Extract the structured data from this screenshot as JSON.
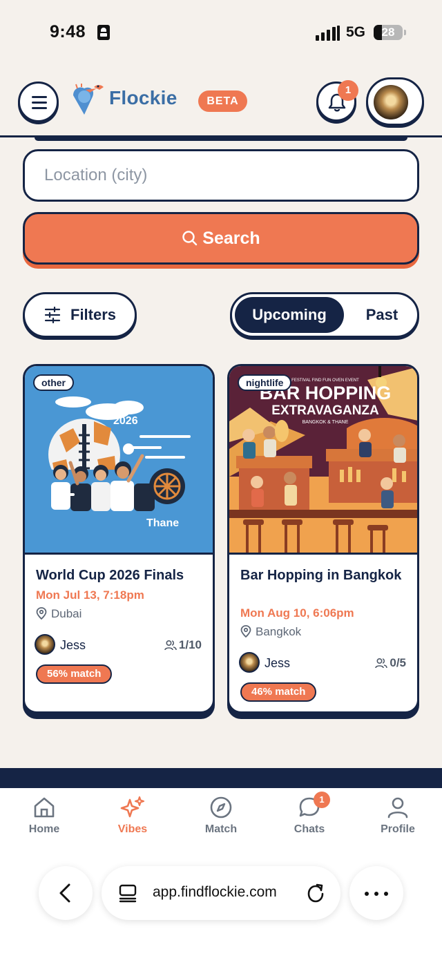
{
  "status_bar": {
    "time": "9:48",
    "network": "5G",
    "battery": "28"
  },
  "header": {
    "brand": "Flockie",
    "beta": "BETA",
    "notification_count": "1",
    "icons": {
      "menu": "hamburger-menu-icon",
      "bell": "bell-icon",
      "logo": "bird-pin-logo"
    }
  },
  "search": {
    "location_placeholder": "Location (city)",
    "location_value": "",
    "search_label": "Search"
  },
  "filters": {
    "label": "Filters"
  },
  "toggle": {
    "upcoming": "Upcoming",
    "past": "Past",
    "selected": "Upcoming"
  },
  "events": [
    {
      "tag": "other",
      "title": "World Cup 2026 Finals",
      "date": "Mon Jul 13, 7:18pm",
      "location": "Dubai",
      "host": "Jess",
      "attendance": "1/10",
      "match": "56% match",
      "poster": {
        "year": "2026",
        "city": "Thane"
      }
    },
    {
      "tag": "nightlife",
      "title": "Bar Hopping in Bangkok",
      "date": "Mon Aug 10, 6:06pm",
      "location": "Bangkok",
      "host": "Jess",
      "attendance": "0/5",
      "match": "46% match",
      "poster": {
        "top": "FESTIVAL FIND FUN OVEN EVENT",
        "line1": "BAR HOPPING",
        "line2": "EXTRAVAGANZA",
        "sub": "BANGKOK & THANE"
      }
    }
  ],
  "nav": {
    "items": [
      {
        "label": "Home",
        "icon": "home-icon"
      },
      {
        "label": "Vibes",
        "icon": "sparkles-icon",
        "active": true
      },
      {
        "label": "Match",
        "icon": "compass-icon"
      },
      {
        "label": "Chats",
        "icon": "chat-bubble-icon"
      },
      {
        "label": "Profile",
        "icon": "person-icon"
      }
    ],
    "chats_badge": "1"
  },
  "browser": {
    "url": "app.findflockie.com"
  },
  "colors": {
    "accent": "#ef7852",
    "navy": "#152445",
    "brand_blue": "#3b6ea5",
    "background": "#f5f1ec"
  }
}
